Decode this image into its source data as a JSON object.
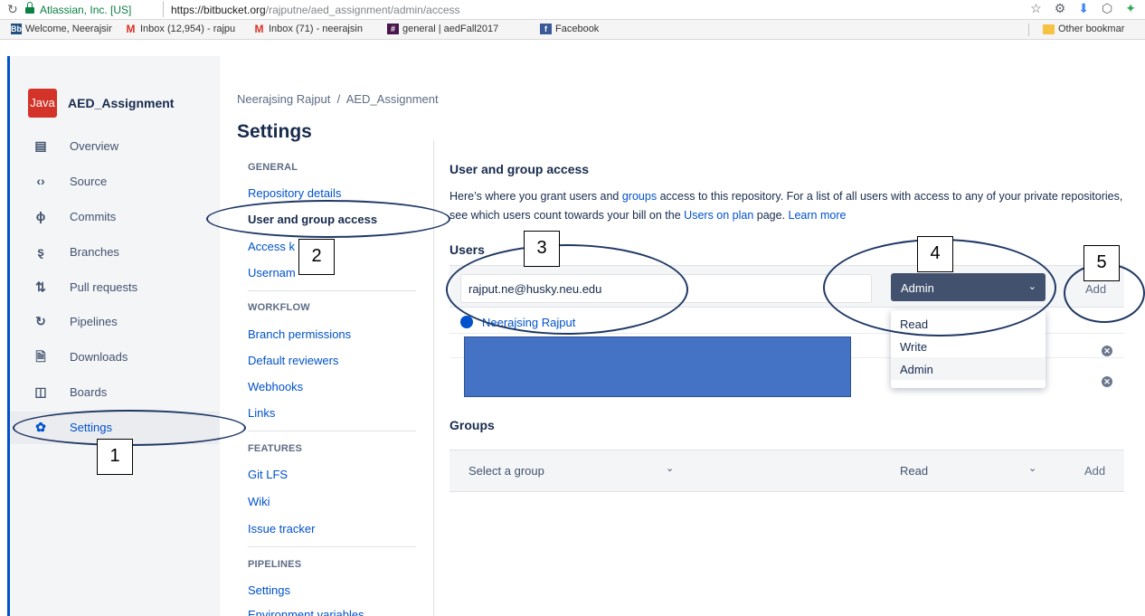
{
  "browser": {
    "site_identity": "Atlassian, Inc. [US]",
    "url_host": "https://bitbucket.org",
    "url_path": "/rajputne/aed_assignment/admin/access",
    "bookmarks": [
      {
        "label": "Welcome, Neerajsing",
        "icon": "bitbucket-icon"
      },
      {
        "label": "Inbox (12,954) - rajpu",
        "icon": "gmail-icon"
      },
      {
        "label": "Inbox (71) - neerajsin",
        "icon": "gmail-icon"
      },
      {
        "label": "general | aedFall2017",
        "icon": "slack-icon"
      },
      {
        "label": "Facebook",
        "icon": "facebook-icon"
      }
    ],
    "other_bookmarks": "Other bookmar"
  },
  "sidebar": {
    "repo_avatar": "Java",
    "repo_name": "AED_Assignment",
    "items": [
      {
        "label": "Overview",
        "icon": "overview-icon"
      },
      {
        "label": "Source",
        "icon": "source-icon"
      },
      {
        "label": "Commits",
        "icon": "commits-icon"
      },
      {
        "label": "Branches",
        "icon": "branches-icon"
      },
      {
        "label": "Pull requests",
        "icon": "pull-requests-icon"
      },
      {
        "label": "Pipelines",
        "icon": "pipelines-icon"
      },
      {
        "label": "Downloads",
        "icon": "downloads-icon"
      },
      {
        "label": "Boards",
        "icon": "boards-icon"
      },
      {
        "label": "Settings",
        "icon": "gear-icon",
        "active": true
      }
    ]
  },
  "header": {
    "breadcrumb_owner": "Neerajsing Rajput",
    "breadcrumb_sep": "/",
    "breadcrumb_repo": "AED_Assignment",
    "title": "Settings"
  },
  "settings_nav": {
    "general_heading": "GENERAL",
    "general": [
      "Repository details",
      "User and group access",
      "Access k",
      "Usernam"
    ],
    "workflow_heading": "WORKFLOW",
    "workflow": [
      "Branch permissions",
      "Default reviewers",
      "Webhooks",
      "Links"
    ],
    "features_heading": "FEATURES",
    "features": [
      "Git LFS",
      "Wiki",
      "Issue tracker"
    ],
    "pipelines_heading": "PIPELINES",
    "pipelines": [
      "Settings",
      "Environment variables"
    ]
  },
  "main": {
    "section_title": "User and group access",
    "desc_part1": "Here’s where you grant users and ",
    "desc_link_groups": "groups",
    "desc_part2": " access to this repository. For a list of all users with access to any of your private repositories, see which users count towards your bill on the ",
    "desc_link_plan": "Users on plan",
    "desc_part3": " page. ",
    "desc_link_learn": "Learn more",
    "users_title": "Users",
    "user_input_value": "rajput.ne@husky.neu.edu",
    "permission_selected": "Admin",
    "add_label": "Add",
    "users": [
      "Neerajsing Rajput"
    ],
    "dropdown_options": [
      "Read",
      "Write",
      "Admin"
    ],
    "groups_title": "Groups",
    "group_select_placeholder": "Select a group",
    "group_permission": "Read",
    "group_add_label": "Add"
  },
  "annotations": [
    "1",
    "2",
    "3",
    "4",
    "5"
  ],
  "colors": {
    "accent": "#0052cc",
    "annotation": "#1f3864",
    "redaction": "#4472c4",
    "repo_avatar_bg": "#d33328",
    "select_bg": "#42526e"
  }
}
